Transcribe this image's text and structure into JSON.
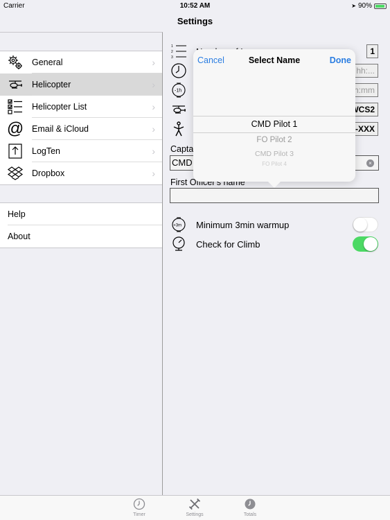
{
  "status": {
    "carrier": "Carrier",
    "time": "10:52 AM",
    "battery": "90%",
    "battery_level": 0.9
  },
  "nav": {
    "title": "Settings"
  },
  "sidebar": {
    "items": [
      {
        "label": "General",
        "icon": "gears-icon"
      },
      {
        "label": "Helicopter",
        "icon": "helicopter-icon",
        "selected": true
      },
      {
        "label": "Helicopter List",
        "icon": "checklist-icon"
      },
      {
        "label": "Email & iCloud",
        "icon": "at-sign-icon"
      },
      {
        "label": "LogTen",
        "icon": "upload-icon"
      },
      {
        "label": "Dropbox",
        "icon": "dropbox-icon"
      }
    ],
    "items2": [
      {
        "label": "Help"
      },
      {
        "label": "About"
      }
    ]
  },
  "detail": {
    "number_of_legs_label": "Number of Legs",
    "number_of_legs_value": "1",
    "time_value_1": "hh:...",
    "time_value_2": "h:mm",
    "helicopter_reg": "WCS2",
    "pilot_code": "-XXX",
    "captain_label": "Capta",
    "captain_value": "CMD",
    "first_officer_label": "First Officer's name",
    "first_officer_value": "",
    "warmup_label": "Minimum 3min warmup",
    "warmup_on": false,
    "climb_label": "Check for Climb",
    "climb_on": true
  },
  "popover": {
    "cancel": "Cancel",
    "title": "Select Name",
    "done": "Done",
    "options": [
      "CMD Pilot 1",
      "FO Pilot 2",
      "CMD Pilot 3",
      "FO Pilot 4"
    ]
  },
  "tabs": [
    {
      "label": "Timer",
      "icon": "clock-icon"
    },
    {
      "label": "Settings",
      "icon": "wrench-screwdriver-icon",
      "active": true
    },
    {
      "label": "Totals",
      "icon": "totals-clock-icon"
    }
  ],
  "colors": {
    "accent": "#2a7de1",
    "toggle_on": "#4cd964",
    "selected_row": "#d9d9d9"
  }
}
